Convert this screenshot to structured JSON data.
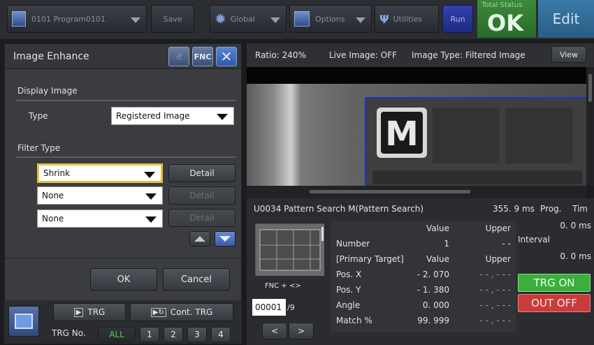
{
  "topbar": {
    "program_label": "0101 Program0101",
    "save_label": "Save",
    "global_label": "Global",
    "options_label": "Options",
    "utilities_label": "Utilities",
    "run_label": "Run",
    "status_title": "Total Status",
    "status_value": "OK",
    "edit_label": "Edit"
  },
  "image_enhance": {
    "title": "Image Enhance",
    "fnc_label": "FNC",
    "display_image_label": "Display Image",
    "type_label": "Type",
    "type_value": "Registered Image",
    "filter_type_label": "Filter Type",
    "filters": [
      {
        "value": "Shrink",
        "detail": "Detail"
      },
      {
        "value": "None",
        "detail": "Detail"
      },
      {
        "value": "None",
        "detail": "Detail"
      }
    ],
    "ok_label": "OK",
    "cancel_label": "Cancel"
  },
  "bottom_left": {
    "trg_label": "TRG",
    "cont_trg_label": "Cont. TRG",
    "trg_no_label": "TRG No.",
    "trg_numbers": [
      "ALL",
      "1",
      "2",
      "3",
      "4"
    ]
  },
  "image_header": {
    "ratio": "Ratio: 240%",
    "live_image": "Live Image: OFF",
    "image_type": "Image Type: Filtered Image",
    "view_label": "View"
  },
  "image_view": {
    "glyph": "M"
  },
  "result": {
    "unit_title": "U0034 Pattern Search M(Pattern Search)",
    "time": "355. 9 ms",
    "prog_label": "Prog.",
    "tim_label": "Tim",
    "fnc_label": "FNC + <>",
    "counter": "00001",
    "counter_total": "/9",
    "prog_value": "0. 0 ms",
    "interval_label": "Interval",
    "interval_value": "0. 0 ms",
    "trg_on_label": "TRG ON",
    "out_off_label": "OUT OFF",
    "prev_label": "<",
    "next_label": ">",
    "table": {
      "header_value": "Value",
      "header_upper": "Upper",
      "rows": [
        {
          "label": "Number",
          "value": "1",
          "upper": "- -"
        },
        {
          "label": "[Primary Target]",
          "value": "Value",
          "upper": "Upper"
        },
        {
          "label": "Pos. X",
          "value": "- 2. 070",
          "upper": "- - , - - -"
        },
        {
          "label": "Pos. Y",
          "value": "- 1. 380",
          "upper": "- - , - - -"
        },
        {
          "label": "Angle",
          "value": "0. 000",
          "upper": "- - , - - -"
        },
        {
          "label": "Match %",
          "value": "99. 999",
          "upper": "- - , - - -"
        }
      ]
    }
  }
}
